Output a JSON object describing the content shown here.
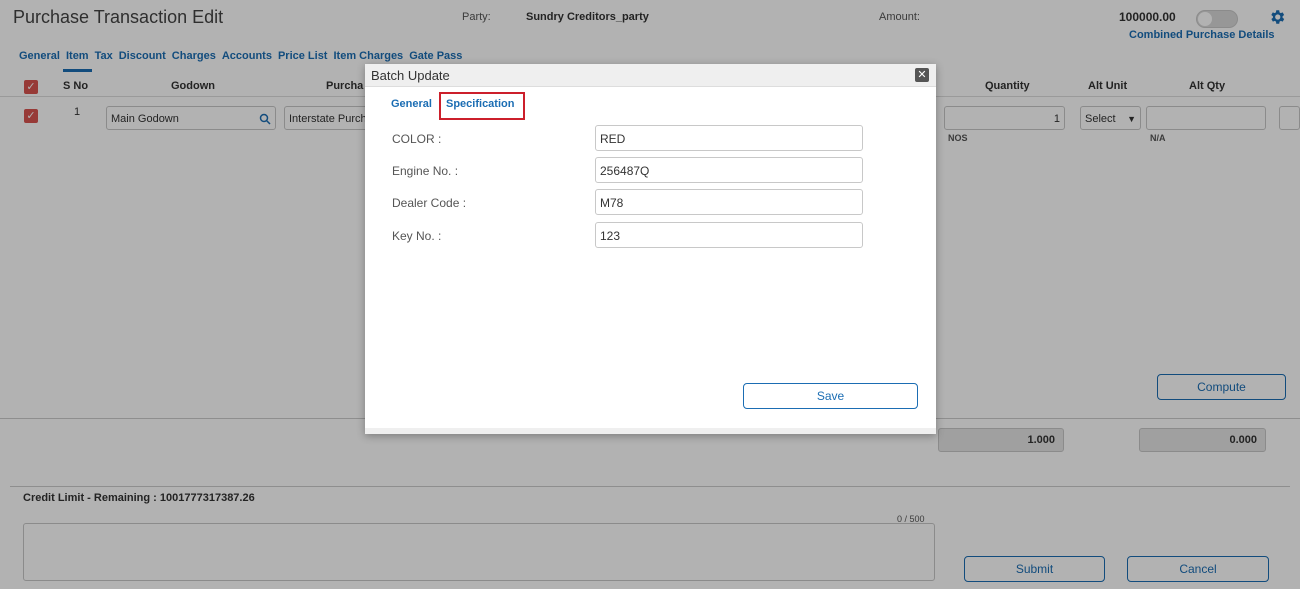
{
  "header": {
    "title": "Purchase Transaction Edit",
    "party_label": "Party:",
    "party_value": "Sundry Creditors_party",
    "amount_label": "Amount:",
    "amount_value": "100000.00",
    "combined_link": "Combined Purchase Details",
    "gear_icon": "gear-icon"
  },
  "tabs": [
    {
      "label": "General"
    },
    {
      "label": "Item",
      "active": true
    },
    {
      "label": "Tax"
    },
    {
      "label": "Discount"
    },
    {
      "label": "Charges"
    },
    {
      "label": "Accounts"
    },
    {
      "label": "Price List"
    },
    {
      "label": "Item Charges"
    },
    {
      "label": "Gate Pass"
    }
  ],
  "grid": {
    "columns": {
      "sno": "S No",
      "godown": "Godown",
      "purchase": "Purcha",
      "quantity": "Quantity",
      "alt_unit": "Alt Unit",
      "alt_qty": "Alt Qty"
    },
    "row": {
      "sno": "1",
      "godown": "Main Godown",
      "purchase": "Interstate Purch",
      "quantity": "1",
      "unit": "NOS",
      "alt_unit": "Select",
      "alt_qty_note": "N/A"
    },
    "compute_label": "Compute",
    "total_qty": "1.000",
    "total_amount": "0.000"
  },
  "footer": {
    "credit_limit": "Credit Limit - Remaining : 1001777317387.26",
    "char_count": "0 / 500",
    "submit_label": "Submit",
    "cancel_label": "Cancel"
  },
  "modal": {
    "title": "Batch Update",
    "close": "✕",
    "tabs": [
      {
        "label": "General"
      },
      {
        "label": "Specification",
        "active": true
      }
    ],
    "fields": [
      {
        "label": "COLOR :",
        "value": "RED"
      },
      {
        "label": "Engine No. :",
        "value": "256487Q"
      },
      {
        "label": "Dealer Code :",
        "value": "M78"
      },
      {
        "label": "Key No. :",
        "value": "123"
      }
    ],
    "save_label": "Save"
  },
  "colors": {
    "accent": "#1b6db3",
    "highlight": "#cc1f2b",
    "checkbox": "#d9534f"
  }
}
